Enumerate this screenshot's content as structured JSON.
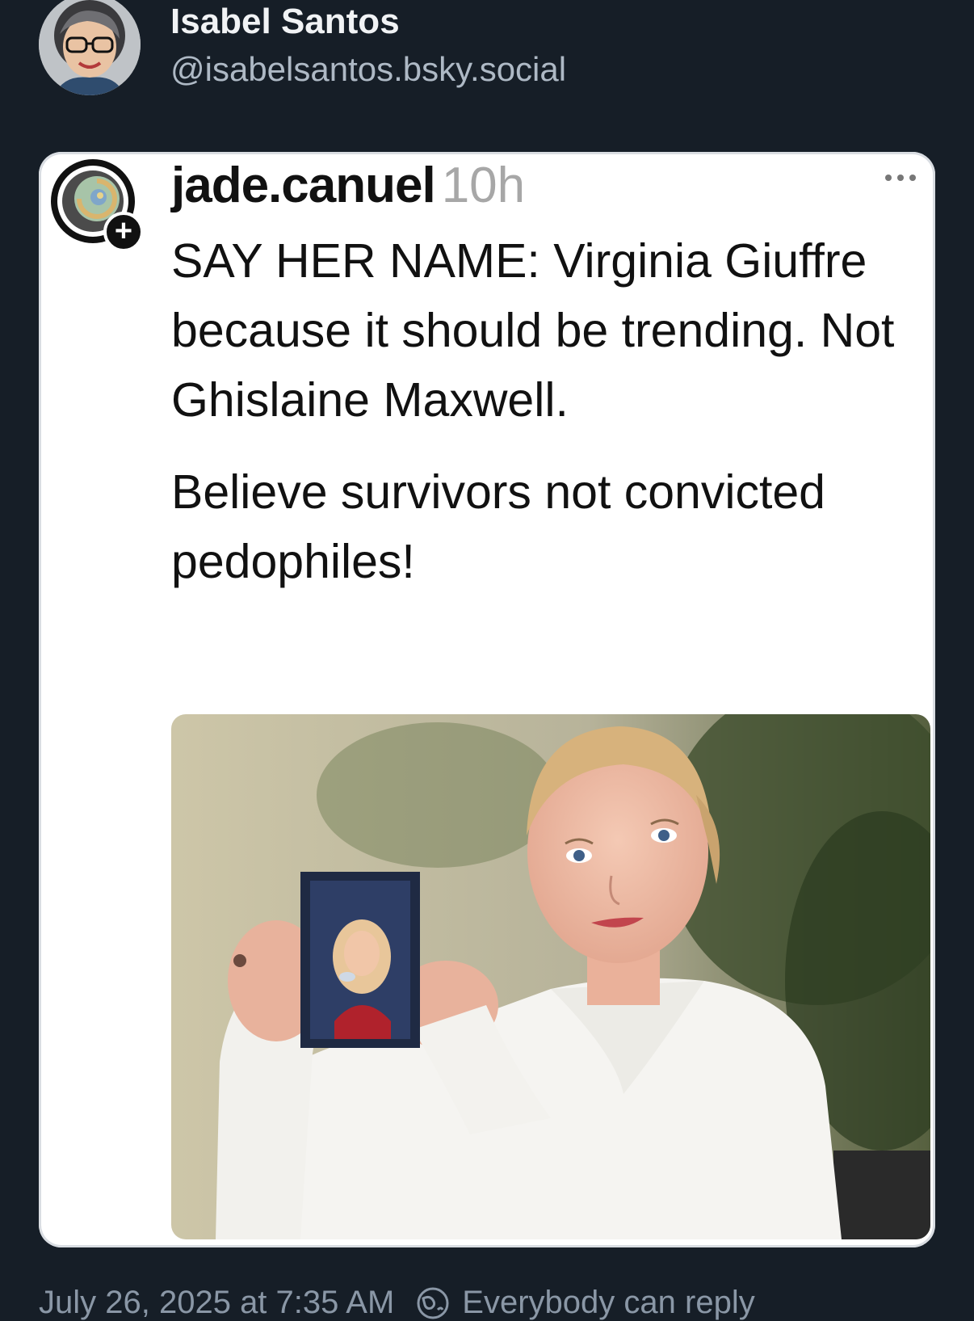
{
  "post": {
    "author_name": "Isabel Santos",
    "author_handle": "@isabelsantos.bsky.social",
    "date": "July 26, 2025 at 7:35 AM",
    "reply_setting": "Everybody can reply"
  },
  "quoted_post": {
    "username": "jade.canuel",
    "time_ago": "10h",
    "paragraph_1": "SAY HER NAME: Virginia Giuffre because it should be trending. Not Ghislaine Maxwell.",
    "paragraph_2": "Believe survivors not convicted pedophiles!",
    "follow_badge": "+"
  },
  "icons": {
    "more": "ellipsis-icon",
    "reply": "globe-icon"
  }
}
